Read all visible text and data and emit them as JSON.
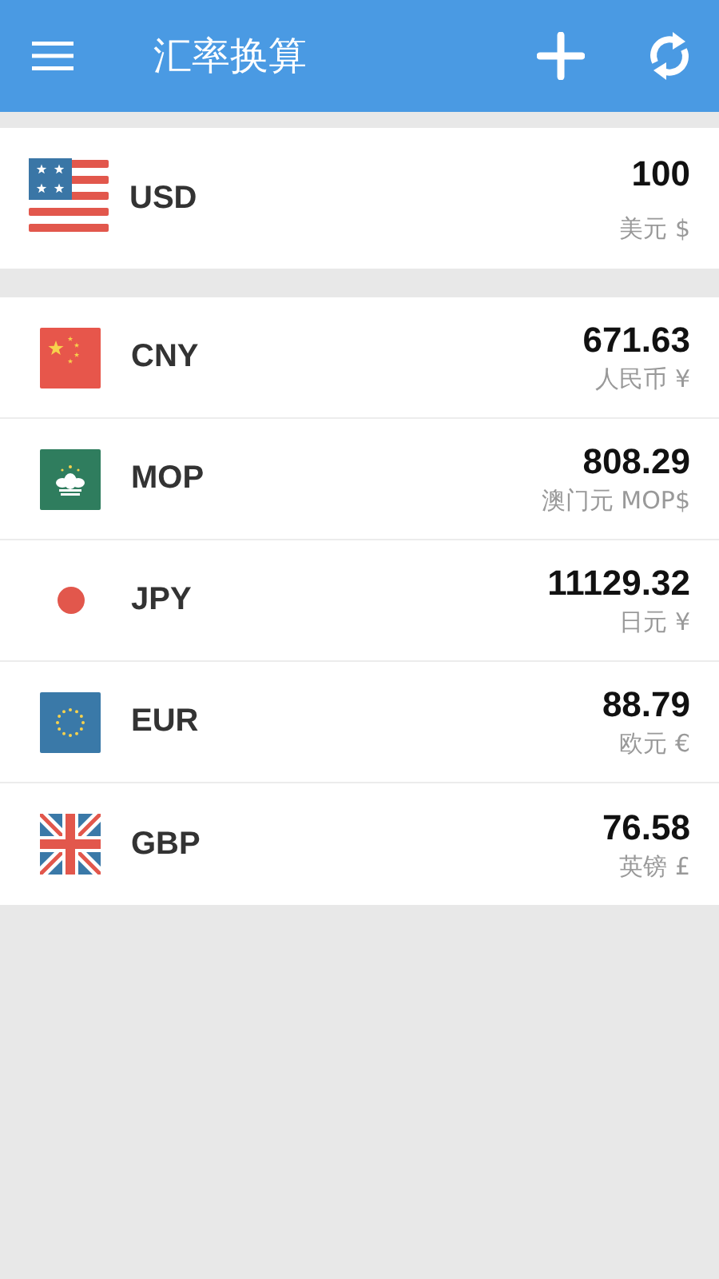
{
  "app_bar": {
    "title": "汇率换算"
  },
  "base": {
    "code": "USD",
    "amount": "100",
    "name": "美元 $"
  },
  "rates": [
    {
      "code": "CNY",
      "amount": "671.63",
      "name": "人民币 ¥"
    },
    {
      "code": "MOP",
      "amount": "808.29",
      "name": "澳门元 MOP$"
    },
    {
      "code": "JPY",
      "amount": "11129.32",
      "name": "日元 ¥"
    },
    {
      "code": "EUR",
      "amount": "88.79",
      "name": "欧元 €"
    },
    {
      "code": "GBP",
      "amount": "76.58",
      "name": "英镑 £"
    }
  ]
}
